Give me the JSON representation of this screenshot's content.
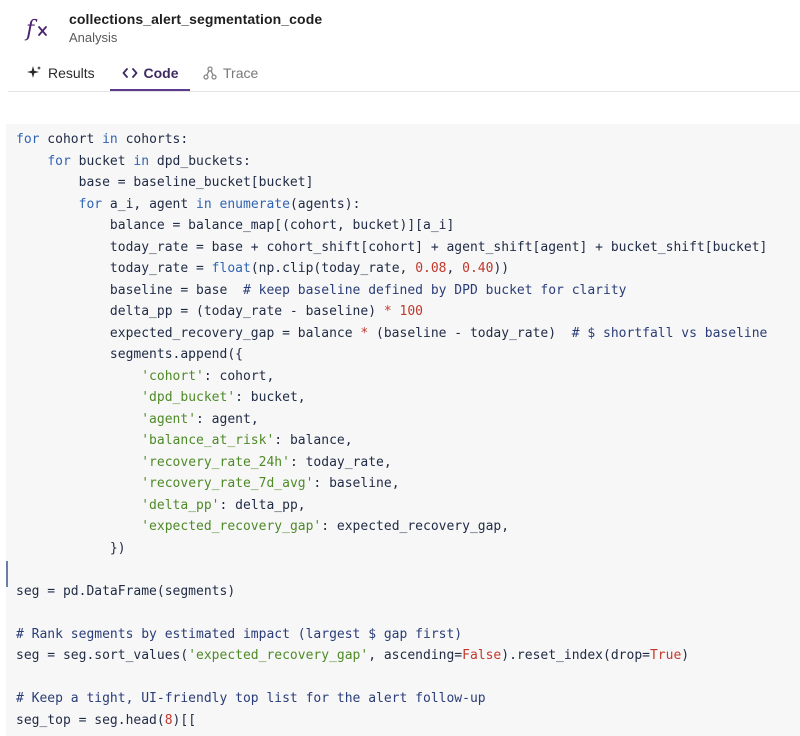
{
  "header": {
    "title": "collections_alert_segmentation_code",
    "subtitle": "Analysis",
    "icon": "function-icon"
  },
  "tabs": [
    {
      "label": "Results",
      "icon": "sparkle-icon",
      "active": false
    },
    {
      "label": "Code",
      "icon": "code-icon",
      "active": true
    },
    {
      "label": "Trace",
      "icon": "trace-icon",
      "active": false
    }
  ],
  "colors": {
    "accent": "#5c3a8f",
    "keyword": "#2f64b4",
    "string": "#4f8a28",
    "number": "#c0392b",
    "comment": "#2a3d78",
    "code_background": "#f7f7f7"
  },
  "code": {
    "language": "python",
    "lines": [
      [
        [
          "kw",
          "for"
        ],
        [
          "txt",
          " cohort "
        ],
        [
          "kw",
          "in"
        ],
        [
          "txt",
          " cohorts:"
        ]
      ],
      [
        [
          "txt",
          "    "
        ],
        [
          "kw",
          "for"
        ],
        [
          "txt",
          " bucket "
        ],
        [
          "kw",
          "in"
        ],
        [
          "txt",
          " dpd_buckets:"
        ]
      ],
      [
        [
          "txt",
          "        base = baseline_bucket[bucket]"
        ]
      ],
      [
        [
          "txt",
          "        "
        ],
        [
          "kw",
          "for"
        ],
        [
          "txt",
          " a_i, agent "
        ],
        [
          "kw",
          "in"
        ],
        [
          "txt",
          " "
        ],
        [
          "fn",
          "enumerate"
        ],
        [
          "txt",
          "(agents):"
        ]
      ],
      [
        [
          "txt",
          "            balance = balance_map[(cohort, bucket)][a_i]"
        ]
      ],
      [
        [
          "txt",
          "            today_rate = base + cohort_shift[cohort] + agent_shift[agent] + bucket_shift[bucket]"
        ]
      ],
      [
        [
          "txt",
          "            today_rate = "
        ],
        [
          "fn",
          "float"
        ],
        [
          "txt",
          "(np.clip(today_rate, "
        ],
        [
          "num",
          "0.08"
        ],
        [
          "txt",
          ", "
        ],
        [
          "num",
          "0.40"
        ],
        [
          "txt",
          "))"
        ]
      ],
      [
        [
          "txt",
          "            baseline = base  "
        ],
        [
          "cm",
          "# keep baseline defined by DPD bucket for clarity"
        ]
      ],
      [
        [
          "txt",
          "            delta_pp = (today_rate - baseline) "
        ],
        [
          "op",
          "*"
        ],
        [
          "txt",
          " "
        ],
        [
          "num",
          "100"
        ]
      ],
      [
        [
          "txt",
          "            expected_recovery_gap = balance "
        ],
        [
          "op",
          "*"
        ],
        [
          "txt",
          " (baseline - today_rate)  "
        ],
        [
          "cm",
          "# $ shortfall vs baseline"
        ]
      ],
      [
        [
          "txt",
          "            segments.append({"
        ]
      ],
      [
        [
          "txt",
          "                "
        ],
        [
          "str",
          "'cohort'"
        ],
        [
          "txt",
          ": cohort,"
        ]
      ],
      [
        [
          "txt",
          "                "
        ],
        [
          "str",
          "'dpd_bucket'"
        ],
        [
          "txt",
          ": bucket,"
        ]
      ],
      [
        [
          "txt",
          "                "
        ],
        [
          "str",
          "'agent'"
        ],
        [
          "txt",
          ": agent,"
        ]
      ],
      [
        [
          "txt",
          "                "
        ],
        [
          "str",
          "'balance_at_risk'"
        ],
        [
          "txt",
          ": balance,"
        ]
      ],
      [
        [
          "txt",
          "                "
        ],
        [
          "str",
          "'recovery_rate_24h'"
        ],
        [
          "txt",
          ": today_rate,"
        ]
      ],
      [
        [
          "txt",
          "                "
        ],
        [
          "str",
          "'recovery_rate_7d_avg'"
        ],
        [
          "txt",
          ": baseline,"
        ]
      ],
      [
        [
          "txt",
          "                "
        ],
        [
          "str",
          "'delta_pp'"
        ],
        [
          "txt",
          ": delta_pp,"
        ]
      ],
      [
        [
          "txt",
          "                "
        ],
        [
          "str",
          "'expected_recovery_gap'"
        ],
        [
          "txt",
          ": expected_recovery_gap,"
        ]
      ],
      [
        [
          "txt",
          "            })"
        ]
      ],
      [],
      [
        [
          "txt",
          "seg = pd.DataFrame(segments)"
        ]
      ],
      [],
      [
        [
          "cm",
          "# Rank segments by estimated impact (largest $ gap first)"
        ]
      ],
      [
        [
          "txt",
          "seg = seg.sort_values("
        ],
        [
          "str",
          "'expected_recovery_gap'"
        ],
        [
          "txt",
          ", ascending="
        ],
        [
          "num",
          "False"
        ],
        [
          "txt",
          ").reset_index(drop="
        ],
        [
          "num",
          "True"
        ],
        [
          "txt",
          ")"
        ]
      ],
      [],
      [
        [
          "cm",
          "# Keep a tight, UI-friendly top list for the alert follow-up"
        ]
      ],
      [
        [
          "txt",
          "seg_top = seg.head("
        ],
        [
          "num",
          "8"
        ],
        [
          "txt",
          ")[["
        ]
      ]
    ]
  }
}
